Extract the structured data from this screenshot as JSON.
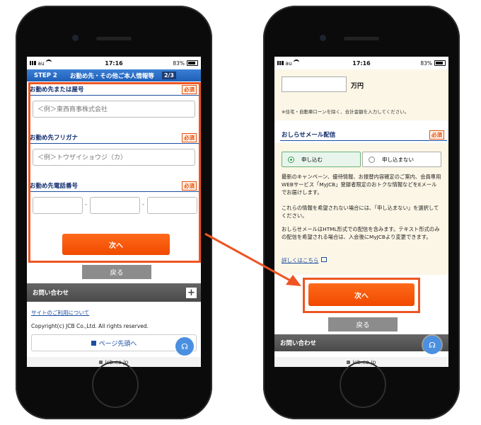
{
  "status": {
    "carrier": "au",
    "time": "17:16",
    "battery": "83%"
  },
  "url": "jcb.co.jp",
  "left": {
    "step_badge": "STEP 2",
    "step_title": "お勤め先・その他ご本人情報等",
    "step_page": "2/3",
    "required_label": "必須",
    "company_name_label": "お勤め先または屋号",
    "company_name_placeholder": "＜例＞東西商事株式会社",
    "company_kana_label": "お勤め先フリガナ",
    "company_kana_placeholder": "＜例＞トウザイショウジ（カ）",
    "phone_label": "お勤め先電話番号",
    "phone_dash": "-",
    "next_button": "次へ",
    "back_button": "戻る",
    "inquiry": "お問い合わせ",
    "site_usage_link": "サイトのご利用について",
    "copyright": "Copyright(c) JCB Co.,Ltd. All rights reserved.",
    "page_top": "ページ先頭へ"
  },
  "right": {
    "amount_unit": "万円",
    "loan_note": "※住宅・自動車ローンを除く、合計金額を入力してください。",
    "mail_title": "おしらせメール配信",
    "required_label": "必須",
    "option_yes": "申し込む",
    "option_no": "申し込まない",
    "para1": "最新のキャンペーン、優待情報、お振替内容確定のご案内、会員専用WEBサービス「MyJCB」登録者限定のおトクな情報などをEメールでお届けします。",
    "para2": "これらの情報を希望されない場合には、「申し込まない」を選択してください。",
    "para3": "おしらせメールはHTML形式での配信を含みます。テキスト形式のみの配信を希望される場合は、入会後にMyJCBより変更できます。",
    "details_link": "詳しくはこちら",
    "next_button": "次へ",
    "back_button": "戻る",
    "inquiry": "お問い合わせ"
  },
  "colors": {
    "accent_orange": "#f04a00",
    "highlight_red": "#ee5522",
    "step_blue": "#1f5fb8",
    "title_navy": "#0e2a6b"
  }
}
